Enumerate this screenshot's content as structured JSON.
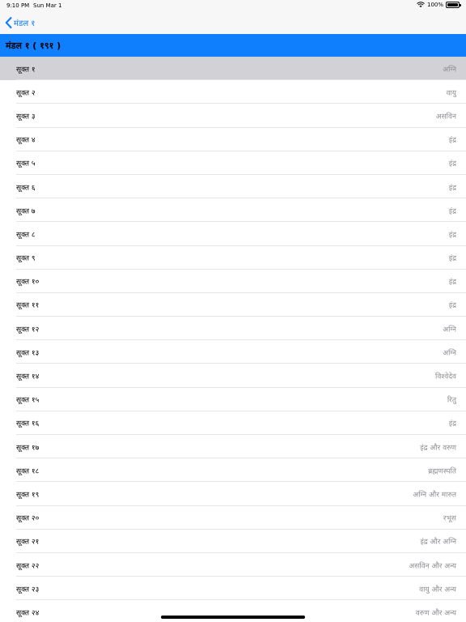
{
  "status": {
    "time": "9:10 PM",
    "date": "Sun Mar 1",
    "battery": "100%"
  },
  "nav": {
    "back_label": "मंडल १"
  },
  "section": {
    "title": "मंडल १  ( १९१ )"
  },
  "rows": [
    {
      "title": "सूक्त १",
      "deity": "अग्नि",
      "selected": true
    },
    {
      "title": "सूक्त २",
      "deity": "वायु"
    },
    {
      "title": "सूक्त ३",
      "deity": "असविन"
    },
    {
      "title": "सूक्त ४",
      "deity": "इंद्र"
    },
    {
      "title": "सूक्त ५",
      "deity": "इंद्र"
    },
    {
      "title": "सूक्त ६",
      "deity": "इंद्र"
    },
    {
      "title": "सूक्त ७",
      "deity": "इंद्र"
    },
    {
      "title": "सूक्त ८",
      "deity": "इंद्र"
    },
    {
      "title": "सूक्त ९",
      "deity": "इंद्र"
    },
    {
      "title": "सूक्त १०",
      "deity": "इंद्र"
    },
    {
      "title": "सूक्त ११",
      "deity": "इंद्र"
    },
    {
      "title": "सूक्त १२",
      "deity": "अग्नि"
    },
    {
      "title": "सूक्त १३",
      "deity": "अग्नि"
    },
    {
      "title": "सूक्त १४",
      "deity": "विश्वेदेव"
    },
    {
      "title": "सूक्त १५",
      "deity": "रितु"
    },
    {
      "title": "सूक्त १६",
      "deity": "इंद्र"
    },
    {
      "title": "सूक्त १७",
      "deity": "इंद्र और वरुण"
    },
    {
      "title": "सूक्त १८",
      "deity": "ब्रह्मणस्पति"
    },
    {
      "title": "सूक्त १९",
      "deity": "अग्नि और मारुत"
    },
    {
      "title": "सूक्त २०",
      "deity": "रभूस"
    },
    {
      "title": "सूक्त २१",
      "deity": "इंद्र और अग्नि"
    },
    {
      "title": "सूक्त २२",
      "deity": "असविन और अन्य"
    },
    {
      "title": "सूक्त २३",
      "deity": "वायु और अन्य"
    },
    {
      "title": "सूक्त २४",
      "deity": "वरुण और अन्य"
    }
  ]
}
